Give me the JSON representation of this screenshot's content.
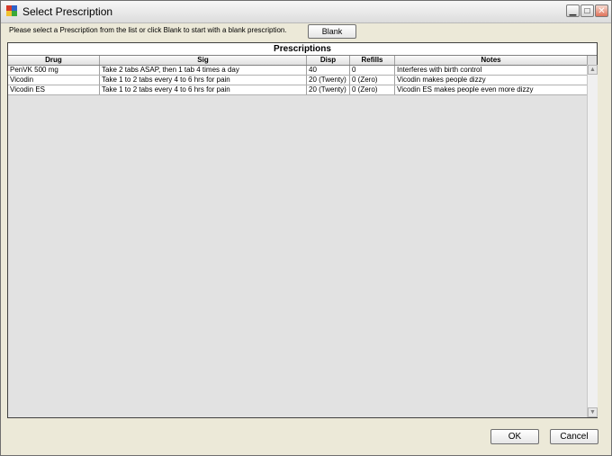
{
  "window": {
    "title": "Select Prescription"
  },
  "titlebar_buttons": {
    "minimize": "▁",
    "maximize": "□",
    "close": "✕"
  },
  "instruction": "Please select a Prescription from the list or click Blank to start with a blank prescription.",
  "blank_button": "Blank",
  "grid": {
    "title": "Prescriptions",
    "columns": [
      "Drug",
      "Sig",
      "Disp",
      "Refills",
      "Notes"
    ],
    "rows": [
      [
        "PenVK 500 mg",
        "Take 2 tabs ASAP, then 1 tab 4 times a day",
        "40",
        "0",
        "Interferes with birth control"
      ],
      [
        "Vicodin",
        "Take 1 to 2 tabs every 4 to 6 hrs for pain",
        "20 (Twenty)",
        "0 (Zero)",
        "Vicodin makes people dizzy"
      ],
      [
        "Vicodin ES",
        "Take 1 to 2 tabs every 4 to 6 hrs for pain",
        "20 (Twenty)",
        "0 (Zero)",
        "Vicodin ES  makes people even more dizzy"
      ]
    ],
    "scroll_up": "▲",
    "scroll_down": "▼"
  },
  "footer": {
    "ok": "OK",
    "cancel": "Cancel"
  }
}
